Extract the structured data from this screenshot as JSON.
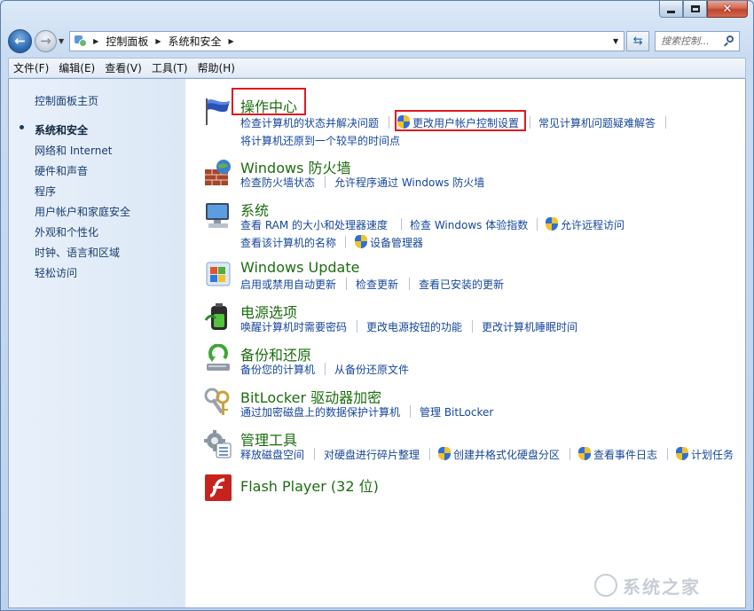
{
  "window": {
    "min_icon": "minimize-icon",
    "max_icon": "maximize-icon",
    "close_icon": "close-icon"
  },
  "navigation": {
    "breadcrumbs": [
      "控制面板",
      "系统和安全"
    ],
    "search_placeholder": "搜索控制...",
    "search_value": ""
  },
  "menu": [
    "文件(F)",
    "编辑(E)",
    "查看(V)",
    "工具(T)",
    "帮助(H)"
  ],
  "sidebar": {
    "home": "控制面板主页",
    "items": [
      {
        "label": "系统和安全",
        "active": true
      },
      {
        "label": "网络和 Internet",
        "active": false
      },
      {
        "label": "硬件和声音",
        "active": false
      },
      {
        "label": "程序",
        "active": false
      },
      {
        "label": "用户帐户和家庭安全",
        "active": false
      },
      {
        "label": "外观和个性化",
        "active": false
      },
      {
        "label": "时钟、语言和区域",
        "active": false
      },
      {
        "label": "轻松访问",
        "active": false
      }
    ]
  },
  "categories": [
    {
      "title": "操作中心",
      "icon": "flag-icon",
      "tasks": [
        "检查计算机的状态并解决问题",
        "更改用户帐户控制设置",
        "常见计算机问题疑难解答",
        "将计算机还原到一个较早的时间点"
      ]
    },
    {
      "title": "Windows 防火墙",
      "icon": "firewall-icon",
      "tasks": [
        "检查防火墙状态",
        "允许程序通过 Windows 防火墙"
      ]
    },
    {
      "title": "系统",
      "icon": "computer-icon",
      "tasks": [
        "查看 RAM 的大小和处理器速度",
        "检查 Windows 体验指数",
        "允许远程访问",
        "查看该计算机的名称",
        "设备管理器"
      ]
    },
    {
      "title": "Windows Update",
      "icon": "windows-update-icon",
      "tasks": [
        "启用或禁用自动更新",
        "检查更新",
        "查看已安装的更新"
      ]
    },
    {
      "title": "电源选项",
      "icon": "battery-icon",
      "tasks": [
        "唤醒计算机时需要密码",
        "更改电源按钮的功能",
        "更改计算机睡眠时间"
      ]
    },
    {
      "title": "备份和还原",
      "icon": "backup-icon",
      "tasks": [
        "备份您的计算机",
        "从备份还原文件"
      ]
    },
    {
      "title": "BitLocker 驱动器加密",
      "icon": "keys-icon",
      "tasks": [
        "通过加密磁盘上的数据保护计算机",
        "管理 BitLocker"
      ]
    },
    {
      "title": "管理工具",
      "icon": "admin-tools-icon",
      "tasks": [
        "释放磁盘空间",
        "对硬盘进行碎片整理",
        "创建并格式化硬盘分区",
        "查看事件日志",
        "计划任务"
      ]
    },
    {
      "title": "Flash Player (32 位)",
      "icon": "flash-player-icon",
      "tasks": []
    }
  ],
  "watermark": "系统之家",
  "colors": {
    "category_title": "#1b6d0f",
    "task_link": "#16469a",
    "highlight_box": "#e0191e"
  }
}
